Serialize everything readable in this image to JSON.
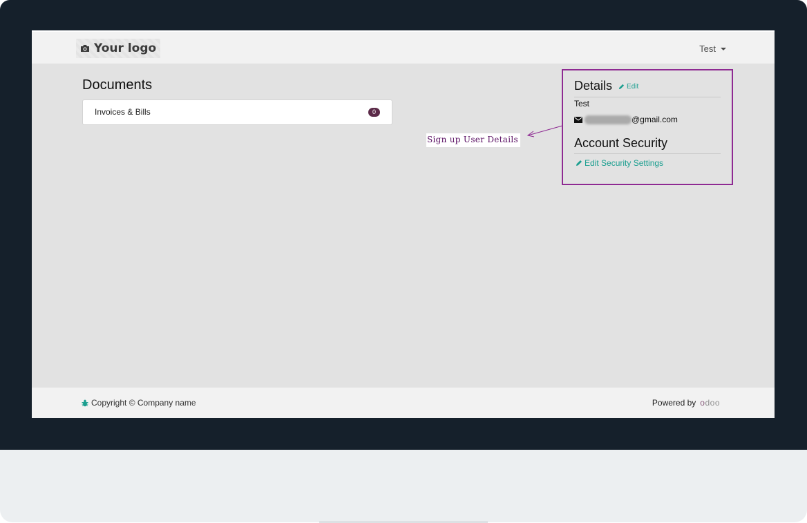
{
  "header": {
    "logo_text": "Your logo",
    "user_menu_label": "Test"
  },
  "documents": {
    "title": "Documents",
    "items": [
      {
        "label": "Invoices & Bills",
        "count": "0"
      }
    ]
  },
  "annotation": {
    "text": "Sign up User Details"
  },
  "details": {
    "title": "Details",
    "edit_label": "Edit",
    "name": "Test",
    "email_suffix": "@gmail.com",
    "security_title": "Account Security",
    "security_link": "Edit Security Settings"
  },
  "footer": {
    "copyright": "Copyright © Company name",
    "powered_by": "Powered by",
    "brand": "odoo"
  },
  "colors": {
    "accent_teal": "#1a9e8f",
    "badge": "#5b2a48",
    "annotation_purple": "#8e2a92",
    "bezel": "#15202b"
  }
}
